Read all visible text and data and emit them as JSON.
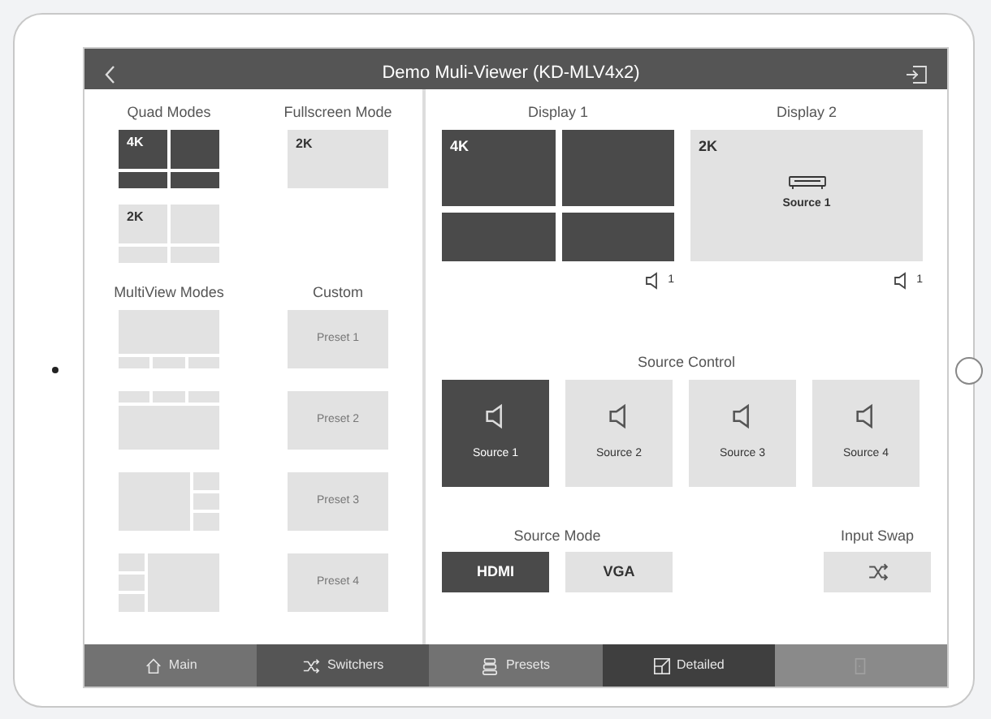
{
  "nav": {
    "title": "Demo Muli-Viewer (KD-MLV4x2)"
  },
  "left": {
    "quad": {
      "title": "Quad Modes",
      "items": [
        {
          "kind": "quad",
          "label": "4K",
          "selected": true
        },
        {
          "kind": "quad",
          "label": "2K",
          "selected": false
        }
      ]
    },
    "fullscreen": {
      "title": "Fullscreen Mode",
      "items": [
        {
          "kind": "full",
          "label": "2K",
          "selected": false
        }
      ]
    },
    "multiview": {
      "title": "MultiView Modes",
      "items": [
        {
          "kind": "top-strip"
        },
        {
          "kind": "bottom-strip"
        },
        {
          "kind": "right-column"
        },
        {
          "kind": "left-column"
        }
      ]
    },
    "custom": {
      "title": "Custom",
      "presets": [
        "Preset 1",
        "Preset 2",
        "Preset 3",
        "Preset 4"
      ]
    }
  },
  "displays": [
    {
      "title": "Display 1",
      "kind": "quad",
      "label": "4K",
      "selected": true,
      "audio": "1"
    },
    {
      "title": "Display 2",
      "kind": "full",
      "label": "2K",
      "selected": false,
      "source": "Source 1",
      "audio": "1"
    }
  ],
  "source_control": {
    "title": "Source Control",
    "sources": [
      {
        "label": "Source 1",
        "selected": true
      },
      {
        "label": "Source 2",
        "selected": false
      },
      {
        "label": "Source 3",
        "selected": false
      },
      {
        "label": "Source 4",
        "selected": false
      }
    ]
  },
  "source_mode": {
    "title": "Source Mode",
    "modes": [
      {
        "label": "HDMI",
        "selected": true
      },
      {
        "label": "VGA",
        "selected": false
      }
    ]
  },
  "input_swap": {
    "title": "Input Swap"
  },
  "tabs": [
    {
      "kind": "home",
      "label": "Main",
      "selected": false,
      "disabled": false
    },
    {
      "kind": "shuffle",
      "label": "Switchers",
      "selected": false,
      "disabled": false
    },
    {
      "kind": "presets",
      "label": "Presets",
      "selected": false,
      "disabled": false
    },
    {
      "kind": "detailed",
      "label": "Detailed",
      "selected": true,
      "disabled": false
    },
    {
      "kind": "door",
      "selected": false,
      "disabled": true
    }
  ]
}
